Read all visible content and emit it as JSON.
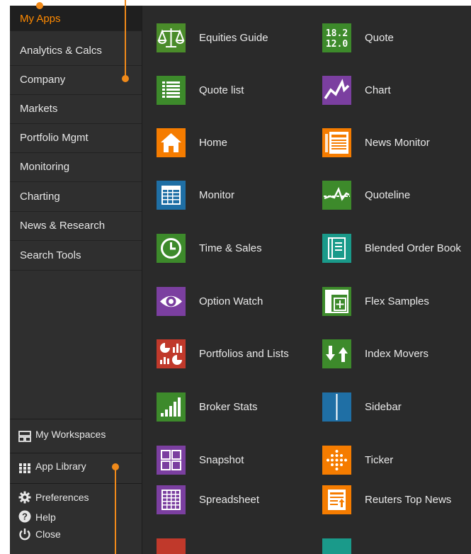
{
  "sidebar": {
    "nav": [
      {
        "label": "My Apps",
        "active": true
      },
      {
        "label": "Analytics & Calcs"
      },
      {
        "label": "Company"
      },
      {
        "label": "Markets"
      },
      {
        "label": "Portfolio Mgmt"
      },
      {
        "label": "Monitoring"
      },
      {
        "label": "Charting"
      },
      {
        "label": "News & Research"
      },
      {
        "label": "Search Tools"
      }
    ],
    "bottom": {
      "my_workspaces": "My Workspaces",
      "app_library": "App Library",
      "preferences": "Preferences",
      "help": "Help",
      "close": "Close"
    }
  },
  "apps": {
    "left": [
      {
        "label": "Equities Guide",
        "icon": "scales-icon",
        "color": "#4a8c2a"
      },
      {
        "label": "Quote list",
        "icon": "list-icon",
        "color": "#3d8a2b"
      },
      {
        "label": "Home",
        "icon": "home-icon",
        "color": "#f57c00"
      },
      {
        "label": "Monitor",
        "icon": "grid-table-icon",
        "color": "#1f6fa5"
      },
      {
        "label": "Time & Sales",
        "icon": "clock-icon",
        "color": "#3d8a2b"
      },
      {
        "label": "Option Watch",
        "icon": "eye-icon",
        "color": "#7b3fa0"
      },
      {
        "label": "Portfolios and Lists",
        "icon": "pie-bar-charts-icon",
        "color": "#c0392b"
      },
      {
        "label": "Broker Stats",
        "icon": "bar-chart-icon",
        "color": "#3d8a2b"
      },
      {
        "label": "Snapshot",
        "icon": "four-squares-icon",
        "color": "#7b3fa0"
      },
      {
        "label": "Spreadsheet",
        "icon": "spreadsheet-icon",
        "color": "#7b3fa0"
      }
    ],
    "right": [
      {
        "label": "Quote",
        "icon": "quote-numbers-icon",
        "color": "#3d8a2b",
        "icon_text_1": "18.2",
        "icon_text_2": "12.0"
      },
      {
        "label": "Chart",
        "icon": "line-chart-icon",
        "color": "#7b3fa0"
      },
      {
        "label": "News Monitor",
        "icon": "newspaper-icon",
        "color": "#f57c00"
      },
      {
        "label": "Quoteline",
        "icon": "quoteline-icon",
        "color": "#3d8a2b"
      },
      {
        "label": "Blended Order Book",
        "icon": "book-icon",
        "color": "#1a9a8a"
      },
      {
        "label": "Flex Samples",
        "icon": "flex-layout-icon",
        "color": "#3d8a2b"
      },
      {
        "label": "Index Movers",
        "icon": "up-down-arrows-icon",
        "color": "#3d8a2b"
      },
      {
        "label": "Sidebar",
        "icon": "sidebar-icon",
        "color": "#1f6fa5"
      },
      {
        "label": "Ticker",
        "icon": "dot-matrix-icon",
        "color": "#f57c00"
      },
      {
        "label": "Reuters Top News",
        "icon": "top-news-icon",
        "color": "#f57c00"
      }
    ]
  },
  "colors": {
    "accent": "#ff8a00",
    "background": "#2a2a2a",
    "sidebar": "#2f2f2f"
  }
}
